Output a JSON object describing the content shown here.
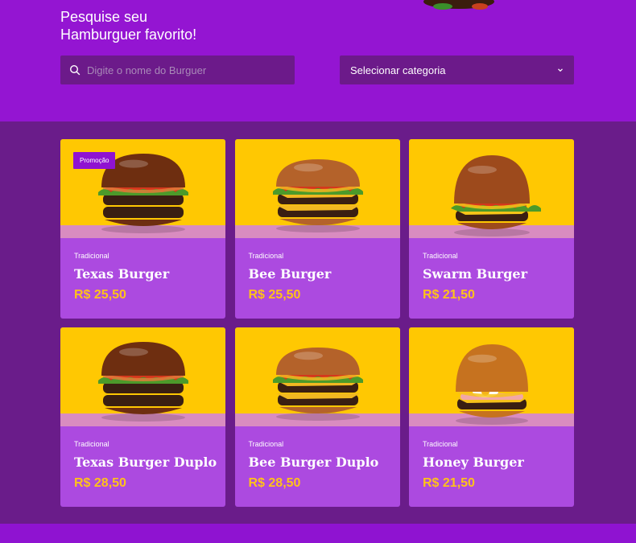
{
  "hero": {
    "title_line1": "Pesquise seu",
    "title_line2": "Hamburguer favorito!",
    "search_placeholder": "Digite o nome do Burguer",
    "category_select": "Selecionar categoria"
  },
  "products": [
    {
      "category": "Tradicional",
      "name": "Texas Burger",
      "price": "R$ 25,50",
      "badge": "Promoção",
      "style": "texas"
    },
    {
      "category": "Tradicional",
      "name": "Bee Burger",
      "price": "R$ 25,50",
      "badge": "",
      "style": "bee"
    },
    {
      "category": "Tradicional",
      "name": "Swarm Burger",
      "price": "R$ 21,50",
      "badge": "",
      "style": "swarm"
    },
    {
      "category": "Tradicional",
      "name": "Texas Burger Duplo",
      "price": "R$ 28,50",
      "badge": "",
      "style": "texas"
    },
    {
      "category": "Tradicional",
      "name": "Bee Burger Duplo",
      "price": "R$ 28,50",
      "badge": "",
      "style": "bee"
    },
    {
      "category": "Tradicional",
      "name": "Honey Burger",
      "price": "R$ 21,50",
      "badge": "",
      "style": "honey"
    }
  ],
  "colors": {
    "brand_purple": "#8f13d1",
    "section_purple": "#6a1c8a",
    "card_purple": "#ac4ae0",
    "image_yellow": "#ffc802",
    "price_yellow": "#ffc21a"
  },
  "icons": {
    "search": "search-icon",
    "select": "chevron-down-icon"
  }
}
